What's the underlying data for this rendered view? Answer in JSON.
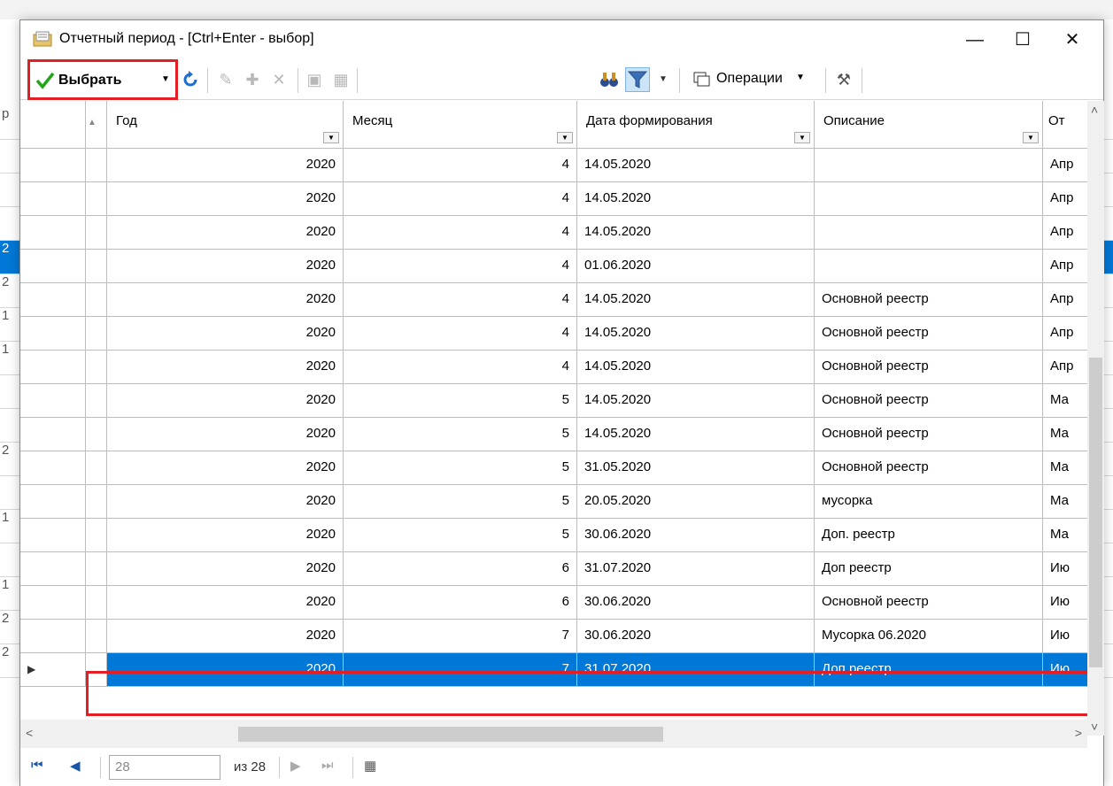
{
  "window": {
    "title": "Отчетный период - [Ctrl+Enter - выбор]",
    "controls": {
      "minimize": "—",
      "maximize": "☐",
      "close": "✕"
    }
  },
  "toolbar": {
    "select_label": "Выбрать",
    "operations_label": "Операции",
    "icons": [
      "refresh-icon",
      "edit-icon",
      "add-icon",
      "delete-icon",
      "save-icon",
      "save-all-icon",
      "binoculars-icon",
      "filter-icon",
      "operations-icon",
      "tools-icon"
    ]
  },
  "grid": {
    "columns": [
      "Год",
      "Месяц",
      "Дата формирования",
      "Описание",
      "От"
    ],
    "rows": [
      {
        "year": "2020",
        "month": "4",
        "date": "14.05.2020",
        "desc": "",
        "extra": "Апр"
      },
      {
        "year": "2020",
        "month": "4",
        "date": "14.05.2020",
        "desc": "",
        "extra": "Апр"
      },
      {
        "year": "2020",
        "month": "4",
        "date": "14.05.2020",
        "desc": "",
        "extra": "Апр"
      },
      {
        "year": "2020",
        "month": "4",
        "date": "01.06.2020",
        "desc": "",
        "extra": "Апр"
      },
      {
        "year": "2020",
        "month": "4",
        "date": "14.05.2020",
        "desc": "Основной реестр",
        "extra": "Апр"
      },
      {
        "year": "2020",
        "month": "4",
        "date": "14.05.2020",
        "desc": "Основной реестр",
        "extra": "Апр"
      },
      {
        "year": "2020",
        "month": "4",
        "date": "14.05.2020",
        "desc": "Основной реестр",
        "extra": "Апр"
      },
      {
        "year": "2020",
        "month": "5",
        "date": "14.05.2020",
        "desc": "Основной реестр",
        "extra": "Ма"
      },
      {
        "year": "2020",
        "month": "5",
        "date": "14.05.2020",
        "desc": "Основной реестр",
        "extra": "Ма"
      },
      {
        "year": "2020",
        "month": "5",
        "date": "31.05.2020",
        "desc": "Основной реестр",
        "extra": "Ма"
      },
      {
        "year": "2020",
        "month": "5",
        "date": "20.05.2020",
        "desc": "мусорка",
        "extra": "Ма"
      },
      {
        "year": "2020",
        "month": "5",
        "date": "30.06.2020",
        "desc": "Доп. реестр",
        "extra": "Ма"
      },
      {
        "year": "2020",
        "month": "6",
        "date": "31.07.2020",
        "desc": "Доп реестр",
        "extra": "Ию"
      },
      {
        "year": "2020",
        "month": "6",
        "date": "30.06.2020",
        "desc": "Основной реестр",
        "extra": "Ию"
      },
      {
        "year": "2020",
        "month": "7",
        "date": "30.06.2020",
        "desc": "Мусорка 06.2020",
        "extra": "Ию"
      },
      {
        "year": "2020",
        "month": "7",
        "date": "31.07.2020",
        "desc": "Доп реестр",
        "extra": "Ию",
        "selected": true
      }
    ]
  },
  "navigator": {
    "current_record": "28",
    "of_total": "из 28"
  },
  "background": {
    "left_fragments": [
      "р",
      "",
      "",
      "",
      "2",
      "2",
      "1",
      "1",
      "",
      "",
      "2",
      "",
      "1",
      "",
      "1",
      "2",
      "2"
    ]
  },
  "colors": {
    "selection": "#0078d7",
    "highlight_border": "#e31e24",
    "check_green": "#22a619"
  }
}
